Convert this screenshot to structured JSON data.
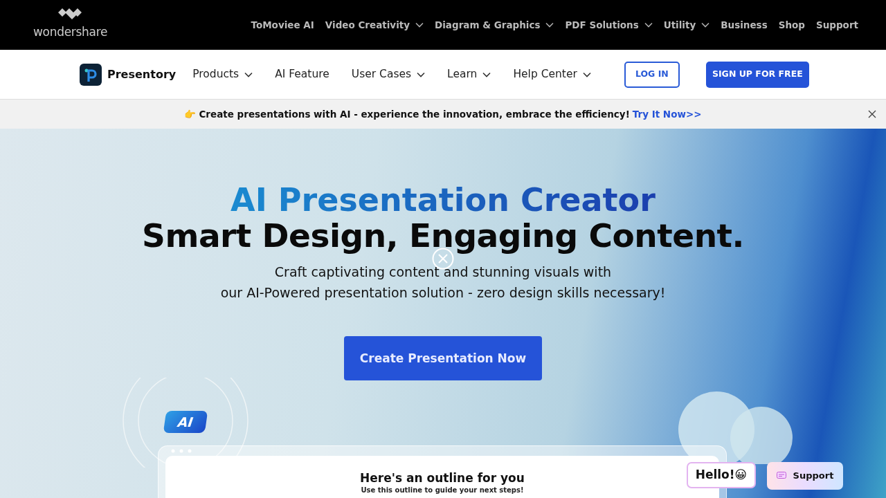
{
  "top_nav": {
    "logo": "wondershare",
    "items": [
      {
        "label": "ToMoviee AI",
        "dropdown": false
      },
      {
        "label": "Video Creativity",
        "dropdown": true
      },
      {
        "label": "Diagram & Graphics",
        "dropdown": true
      },
      {
        "label": "PDF Solutions",
        "dropdown": true
      },
      {
        "label": "Utility",
        "dropdown": true
      },
      {
        "label": "Business",
        "dropdown": false
      },
      {
        "label": "Shop",
        "dropdown": false
      },
      {
        "label": "Support",
        "dropdown": false
      }
    ]
  },
  "product_nav": {
    "brand": "Presentory",
    "items": [
      {
        "label": "Products",
        "dropdown": true
      },
      {
        "label": "AI Feature",
        "dropdown": false
      },
      {
        "label": "User Cases",
        "dropdown": true
      },
      {
        "label": "Learn",
        "dropdown": true
      },
      {
        "label": "Help Center",
        "dropdown": true
      }
    ],
    "login": "LOG IN",
    "signup": "SIGN UP FOR FREE"
  },
  "promo": {
    "emoji": "👉",
    "text": "Create presentations with AI - experience the innovation, embrace the efficiency!",
    "link": "Try It Now>>"
  },
  "hero": {
    "title": "AI Presentation Creator",
    "subtitle": "Smart Design, Engaging Content.",
    "description": [
      "Craft captivating content and stunning visuals with",
      "our AI-Powered presentation solution - zero design skills necessary!"
    ],
    "cta": "Create Presentation Now"
  },
  "mockup": {
    "badge": "AI",
    "heading": "Here's an outline for you",
    "subheading": "Use this outline to guide your next steps!"
  },
  "widgets": {
    "hello": "Hello!😀",
    "support": "Support"
  }
}
